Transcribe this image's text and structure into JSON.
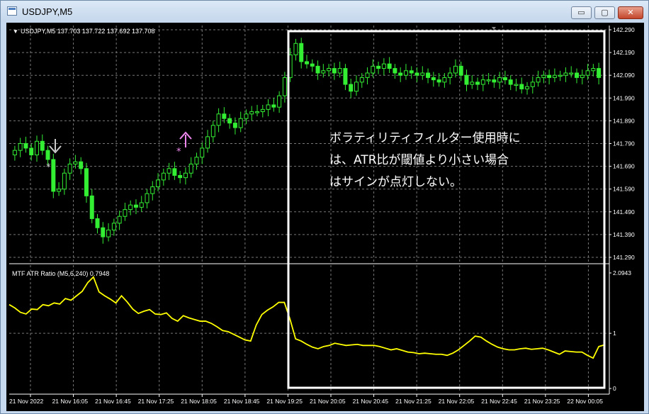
{
  "window": {
    "title": "USDJPY,M5",
    "buttons": {
      "minimize": "▭",
      "maximize": "▢",
      "close": "✕"
    }
  },
  "chart": {
    "header": "USDJPY,M5  137.703 137.722 137.692 137.708",
    "price_ticks": [
      "142.290",
      "142.190",
      "142.090",
      "141.990",
      "141.890",
      "141.790",
      "141.690",
      "141.590",
      "141.490",
      "141.390",
      "141.290"
    ],
    "time_ticks": [
      "21 Nov 2022",
      "21 Nov 16:05",
      "21 Nov 16:45",
      "21 Nov 17:25",
      "21 Nov 18:05",
      "21 Nov 18:45",
      "21 Nov 19:25",
      "21 Nov 20:05",
      "21 Nov 20:45",
      "21 Nov 21:25",
      "21 Nov 22:05",
      "21 Nov 22:45",
      "21 Nov 23:25",
      "22 Nov 00:05"
    ],
    "colors": {
      "background": "#000000",
      "candle": "#33ee33",
      "grid": "#777777",
      "indicator": "#ffff00",
      "arrow_down": "#cccccc",
      "arrow_up": "#ee88ee",
      "highlight_box": "#ffffff"
    }
  },
  "indicator": {
    "header": "MTF ATR Ratio  (M5,6,240) 0.7948",
    "ticks": [
      "2.0943",
      "1",
      "0"
    ]
  },
  "annotation": {
    "lines": [
      "ボラティリティフィルター使用時に",
      "は、ATR比が閾値より小さい場合",
      "はサインが点灯しない。"
    ]
  },
  "chart_data": [
    {
      "type": "candlestick",
      "series": "USDJPY M5",
      "ylim": [
        141.29,
        142.29
      ],
      "close": [
        141.76,
        141.79,
        141.77,
        141.74,
        141.8,
        141.76,
        141.72,
        141.58,
        141.59,
        141.66,
        141.7,
        141.71,
        141.68,
        141.56,
        141.46,
        141.42,
        141.38,
        141.41,
        141.44,
        141.47,
        141.5,
        141.52,
        141.51,
        141.53,
        141.57,
        141.6,
        141.63,
        141.66,
        141.68,
        141.65,
        141.64,
        141.66,
        141.7,
        141.73,
        141.77,
        141.82,
        141.87,
        141.92,
        141.9,
        141.88,
        141.86,
        141.9,
        141.92,
        141.93,
        141.93,
        141.94,
        141.96,
        141.95,
        142.0,
        142.08,
        142.18,
        142.23,
        142.15,
        142.14,
        142.13,
        142.1,
        142.11,
        142.12,
        142.1,
        142.12,
        142.05,
        142.02,
        142.06,
        142.08,
        142.1,
        142.13,
        142.12,
        142.14,
        142.12,
        142.1,
        142.09,
        142.11,
        142.1,
        142.09,
        142.1,
        142.08,
        142.07,
        142.06,
        142.08,
        142.1,
        142.13,
        142.09,
        142.05,
        142.06,
        142.05,
        142.07,
        142.07,
        142.06,
        142.08,
        142.07,
        142.05,
        142.05,
        142.03,
        142.04,
        142.06,
        142.08,
        142.09,
        142.08,
        142.09,
        142.09,
        142.1,
        142.1,
        142.08,
        142.09,
        142.11,
        142.12,
        142.08
      ],
      "signals": [
        {
          "type": "sell",
          "time": "21 Nov 15:50"
        },
        {
          "type": "buy",
          "time": "21 Nov 17:30"
        }
      ]
    },
    {
      "type": "line",
      "series": "MTF ATR Ratio (M5,6,240)",
      "ylim": [
        0,
        2.0943
      ],
      "last_value": 0.7948,
      "values": [
        1.52,
        1.46,
        1.38,
        1.35,
        1.44,
        1.43,
        1.52,
        1.5,
        1.55,
        1.53,
        1.63,
        1.6,
        1.68,
        1.76,
        1.92,
        2.02,
        1.75,
        1.68,
        1.62,
        1.55,
        1.68,
        1.57,
        1.44,
        1.36,
        1.4,
        1.43,
        1.35,
        1.34,
        1.37,
        1.27,
        1.22,
        1.32,
        1.28,
        1.25,
        1.22,
        1.22,
        1.18,
        1.12,
        1.05,
        1.03,
        0.98,
        0.93,
        0.88,
        0.86,
        1.15,
        1.34,
        1.42,
        1.48,
        1.56,
        1.56,
        1.26,
        0.9,
        0.86,
        0.8,
        0.75,
        0.72,
        0.76,
        0.78,
        0.82,
        0.8,
        0.78,
        0.79,
        0.8,
        0.78,
        0.78,
        0.78,
        0.76,
        0.73,
        0.7,
        0.72,
        0.69,
        0.66,
        0.65,
        0.63,
        0.64,
        0.63,
        0.62,
        0.62,
        0.6,
        0.64,
        0.7,
        0.78,
        0.86,
        0.95,
        0.93,
        0.86,
        0.8,
        0.75,
        0.72,
        0.7,
        0.7,
        0.72,
        0.73,
        0.71,
        0.72,
        0.73,
        0.7,
        0.66,
        0.62,
        0.68,
        0.67,
        0.66,
        0.66,
        0.6,
        0.55,
        0.76,
        0.79
      ]
    }
  ]
}
